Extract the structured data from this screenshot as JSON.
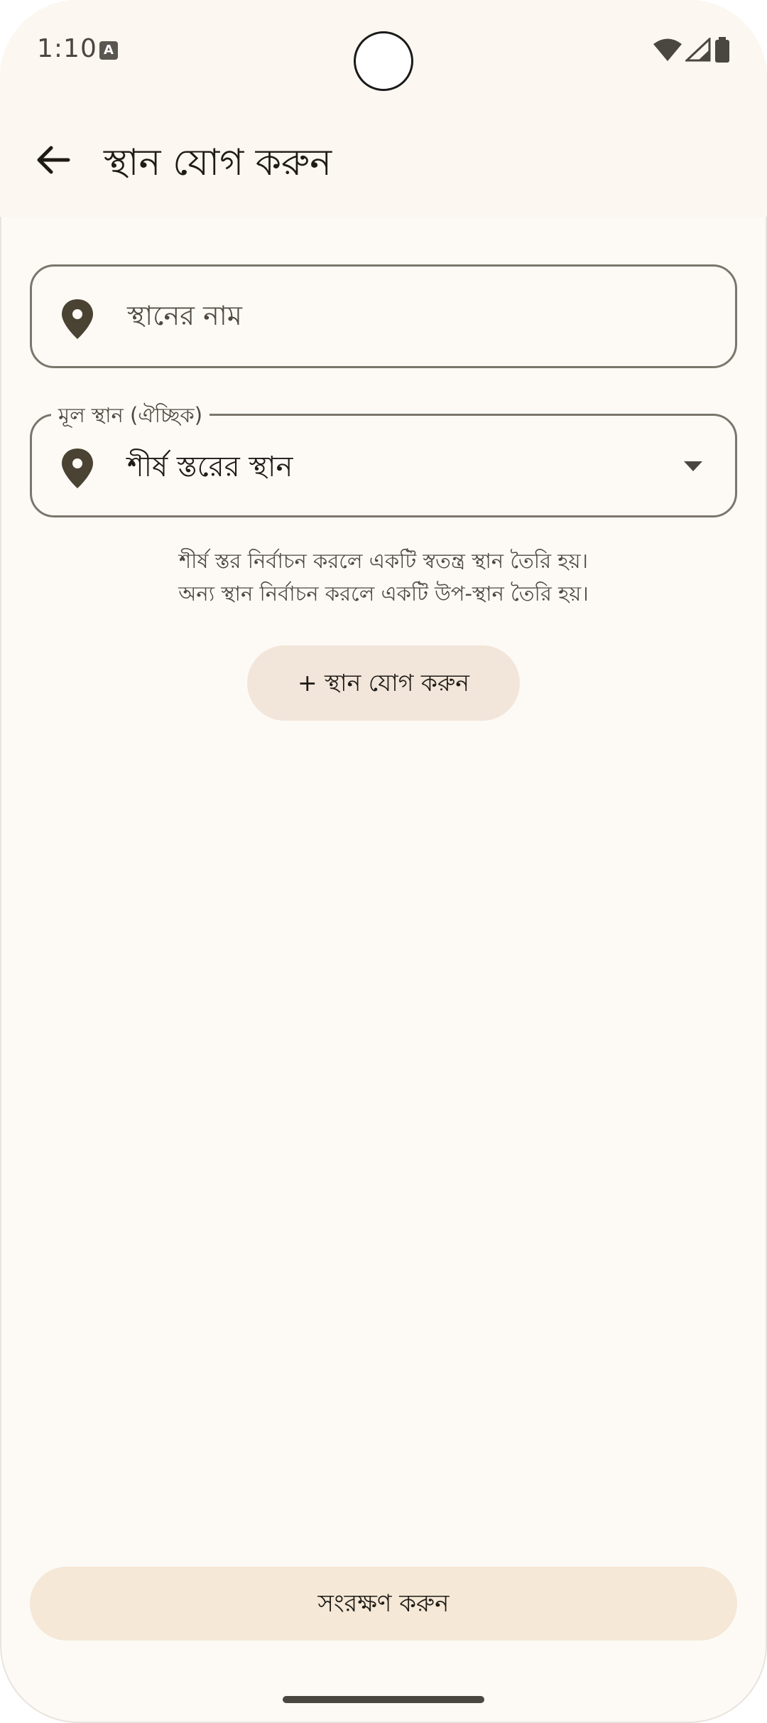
{
  "status_bar": {
    "time": "1:10",
    "notification_icon": "a-icon"
  },
  "app_bar": {
    "title": "স্থান যোগ করুন",
    "back_icon": "arrow-back-icon"
  },
  "form": {
    "name_field": {
      "placeholder": "স্থানের নাম",
      "icon": "location-pin-icon"
    },
    "parent_field": {
      "label": "মূল স্থান (ঐচ্ছিক)",
      "value": "শীর্ষ স্তরের স্থান",
      "icon": "location-pin-icon"
    },
    "helper_line1": "শীর্ষ স্তর নির্বাচন করলে একটি স্বতন্ত্র স্থান তৈরি হয়।",
    "helper_line2": "অন্য স্থান নির্বাচন করলে একটি উপ-স্থান তৈরি হয়।",
    "add_button_label": "+ স্থান যোগ করুন"
  },
  "save_button_label": "সংরক্ষণ করুন",
  "colors": {
    "background": "#FDFAF6",
    "top_band": "#FCF7F0",
    "outline": "#7b766c",
    "tonal_button": "#F2E6DA",
    "save_button": "#F5E8D6",
    "icon": "#4a4232"
  }
}
